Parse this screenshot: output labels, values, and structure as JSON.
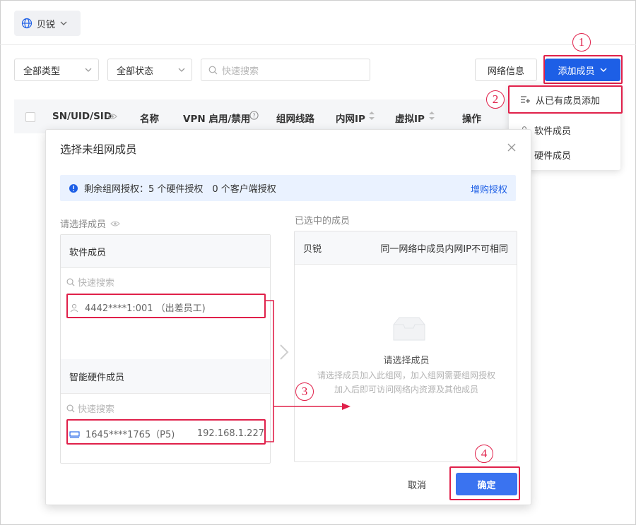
{
  "org_selector": {
    "label": "贝锐",
    "icon": "globe-icon"
  },
  "filters": {
    "type_select": "全部类型",
    "status_select": "全部状态",
    "search_placeholder": "快速搜索"
  },
  "toolbar": {
    "network_info": "网络信息",
    "add_member": "添加成员"
  },
  "table": {
    "columns": [
      "SN/UID/SID",
      "名称",
      "VPN 启用/禁用",
      "组网线路",
      "内网IP",
      "虚拟IP",
      "操作"
    ]
  },
  "dropdown": {
    "items": [
      "从已有成员添加",
      "软件成员",
      "硬件成员"
    ]
  },
  "dialog": {
    "title": "选择未组网成员",
    "info_text": "剩余组网授权：5 个硬件授权　0 个客户端授权",
    "buy_link": "增购授权",
    "left_label": "请选择成员",
    "right_label": "已选中的成员",
    "software_group": "软件成员",
    "software_search": "快速搜索",
    "software_member": "4442****1:001 （出差员工)",
    "hardware_group": "智能硬件成员",
    "hardware_search": "快速搜索",
    "hardware_member_name": "1645****1765（P5)",
    "hardware_member_ip": "192.168.1.227",
    "right_head_left": "贝锐",
    "right_head_right": "同一网络中成员内网IP不可相同",
    "empty_title": "请选择成员",
    "empty_hint_line1": "请选择成员加入此组网，加入组网需要组网授权",
    "empty_hint_line2": "加入后即可访问网络内资源及其他成员",
    "cancel": "取消",
    "confirm": "确定"
  },
  "annotations": {
    "step1": "1",
    "step2": "2",
    "step3": "3",
    "step4": "4"
  },
  "colors": {
    "primary": "#1d5fe6",
    "annotation": "#e0204a",
    "info_bg": "#eaf2ff"
  }
}
